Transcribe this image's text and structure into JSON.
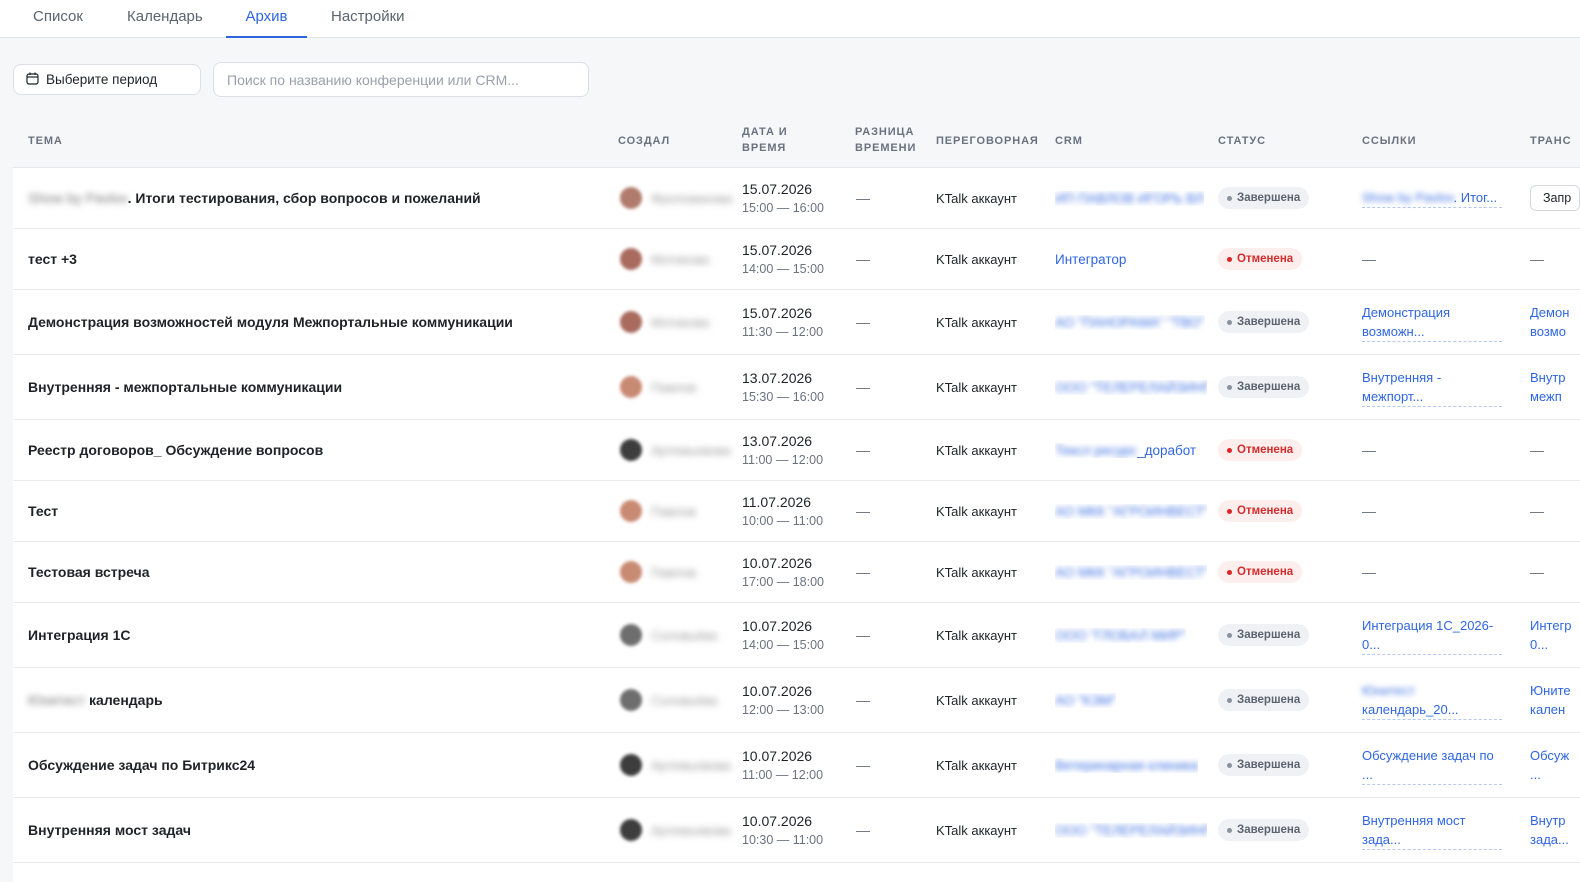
{
  "tabs": [
    {
      "label": "Список",
      "active": false
    },
    {
      "label": "Календарь",
      "active": false
    },
    {
      "label": "Архив",
      "active": true
    },
    {
      "label": "Настройки",
      "active": false
    }
  ],
  "toolbar": {
    "period_label": "Выберите период",
    "period_icon": "calendar-icon",
    "search_value": "",
    "search_placeholder": "Поиск по названию конференции или CRM..."
  },
  "table": {
    "columns": {
      "topic": "ТЕМА",
      "creator": "СОЗДАЛ",
      "datetime": [
        "ДАТА И",
        "ВРЕМЯ"
      ],
      "timediff": [
        "РАЗНИЦА",
        "ВРЕМЕНИ"
      ],
      "room": "ПЕРЕГОВОРНАЯ",
      "crm": "CRM",
      "status": "СТАТУС",
      "links": "ССЫЛКИ",
      "trans": "ТРАНС"
    },
    "rows": [
      {
        "topic_blur": "Show by Pavlov",
        "topic": ". Итоги тестирования, сбор вопросов и пожеланий",
        "creator": "Фролованова",
        "avatar": "#b07a6c",
        "date": "15.07.2026",
        "time": "15:00 — 16:00",
        "diff": "—",
        "room": "KTalk аккаунт",
        "crm_clear": "",
        "crm_blur": "ИП ПАВЛОВ ИГОРЬ ВЛ",
        "status": "Завершена",
        "status_kind": "done",
        "link_blur": "Show by Pavlov",
        "link_text": ". Итог...",
        "trans_kind": "button",
        "trans": "Запр"
      },
      {
        "topic_blur": "",
        "topic": "тест +3",
        "creator": "Мотикова",
        "avatar": "#a86b5e",
        "date": "15.07.2026",
        "time": "14:00 — 15:00",
        "diff": "—",
        "room": "KTalk аккаунт",
        "crm_clear": "Интегратор",
        "crm_blur": "",
        "status": "Отменена",
        "status_kind": "cancel",
        "link_text": "—",
        "trans_kind": "dash",
        "trans": "—"
      },
      {
        "topic_blur": "",
        "topic": "Демонстрация возможностей модуля Межпортальные коммуникации",
        "creator": "Мотикова",
        "avatar": "#a86b5e",
        "date": "15.07.2026",
        "time": "11:30 — 12:00",
        "diff": "—",
        "room": "KTalk аккаунт",
        "crm_clear": "",
        "crm_blur": "АО \"ПАНОРАМА\" \"ТВО\"",
        "status": "Завершена",
        "status_kind": "done",
        "link_l1": "Демонстрация",
        "link_l2": "возможн...",
        "trans_kind": "link",
        "trans_l1": "Демон",
        "trans_l2": "возмо"
      },
      {
        "topic_blur": "",
        "topic": "Внутренняя - межпортальные коммуникации",
        "creator": "Павлов",
        "avatar": "#c98a74",
        "date": "13.07.2026",
        "time": "15:30 — 16:00",
        "diff": "—",
        "room": "KTalk аккаунт",
        "crm_clear": "",
        "crm_blur": "ООО \"ТЕЛЕРЕЛАЙЗИНГ\"",
        "status": "Завершена",
        "status_kind": "done",
        "link_l1": "Внутренняя -",
        "link_l2": "межпорт...",
        "trans_kind": "link",
        "trans_l1": "Внутр",
        "trans_l2": "межп"
      },
      {
        "topic_blur": "",
        "topic": "Реестр договоров_ Обсуждение вопросов",
        "creator": "Артемьевова",
        "avatar": "#3d3d3d",
        "date": "13.07.2026",
        "time": "11:00 — 12:00",
        "diff": "—",
        "room": "KTalk аккаунт",
        "crm_clear": "_доработ",
        "crm_blur": "Тексл ресурс",
        "status": "Отменена",
        "status_kind": "cancel",
        "link_text": "—",
        "trans_kind": "dash",
        "trans": "—"
      },
      {
        "topic_blur": "",
        "topic": "Тест",
        "creator": "Павлов",
        "avatar": "#c98a74",
        "date": "11.07.2026",
        "time": "10:00 — 11:00",
        "diff": "—",
        "room": "KTalk аккаунт",
        "crm_clear": "",
        "crm_blur": "АО МКК \"АГРОИНВЕСТ\"",
        "status": "Отменена",
        "status_kind": "cancel",
        "link_text": "—",
        "trans_kind": "dash",
        "trans": "—"
      },
      {
        "topic_blur": "",
        "topic": "Тестовая встреча",
        "creator": "Павлов",
        "avatar": "#c98a74",
        "date": "10.07.2026",
        "time": "17:00 — 18:00",
        "diff": "—",
        "room": "KTalk аккаунт",
        "crm_clear": "",
        "crm_blur": "АО МКК \"АГРОИНВЕСТ\"",
        "status": "Отменена",
        "status_kind": "cancel",
        "link_text": "—",
        "trans_kind": "dash",
        "trans": "—"
      },
      {
        "topic_blur": "",
        "topic": "Интеграция 1С",
        "creator": "Соловьёва",
        "avatar": "#6e6e6e",
        "date": "10.07.2026",
        "time": "14:00 — 15:00",
        "diff": "—",
        "room": "KTalk аккаунт",
        "crm_clear": "",
        "crm_blur": "ООО \"ГЛОБАЛ МИР\"",
        "status": "Завершена",
        "status_kind": "done",
        "link_l1": "Интеграция 1С_2026-",
        "link_l2": "0...",
        "trans_kind": "link",
        "trans_l1": "Интегр",
        "trans_l2": "0..."
      },
      {
        "topic_blur": "Юнитест",
        "topic": " календарь",
        "creator": "Соловьёва",
        "avatar": "#6e6e6e",
        "date": "10.07.2026",
        "time": "12:00 — 13:00",
        "diff": "—",
        "room": "KTalk аккаунт",
        "crm_clear": "",
        "crm_blur": "АО \"КЭМ\"",
        "status": "Завершена",
        "status_kind": "done",
        "link_blur": "Юнитест",
        "link_l2": "календарь_20...",
        "trans_kind": "link",
        "trans_l1": "Юните",
        "trans_l2": "кален"
      },
      {
        "topic_blur": "",
        "topic": "Обсуждение задач по Битрикс24",
        "creator": "Артемьевова",
        "avatar": "#3d3d3d",
        "date": "10.07.2026",
        "time": "11:00 — 12:00",
        "diff": "—",
        "room": "KTalk аккаунт",
        "crm_clear": "",
        "crm_blur": "Ветеринарная клиника",
        "status": "Завершена",
        "status_kind": "done",
        "link_l1": "Обсуждение задач по",
        "link_l2": "...",
        "trans_kind": "link",
        "trans_l1": "Обсуж",
        "trans_l2": "..."
      },
      {
        "topic_blur": "",
        "topic": "Внутренняя мост задач",
        "creator": "Артемьевова",
        "avatar": "#3d3d3d",
        "date": "10.07.2026",
        "time": "10:30 — 11:00",
        "diff": "—",
        "room": "KTalk аккаунт",
        "crm_clear": "",
        "crm_blur": "ООО \"ТЕЛЕРЕЛАЙЗИНГ\"",
        "status": "Завершена",
        "status_kind": "done",
        "link_l1": "Внутренняя мост",
        "link_l2": "зада...",
        "trans_kind": "link",
        "trans_l1": "Внутр",
        "trans_l2": "зада..."
      }
    ]
  }
}
